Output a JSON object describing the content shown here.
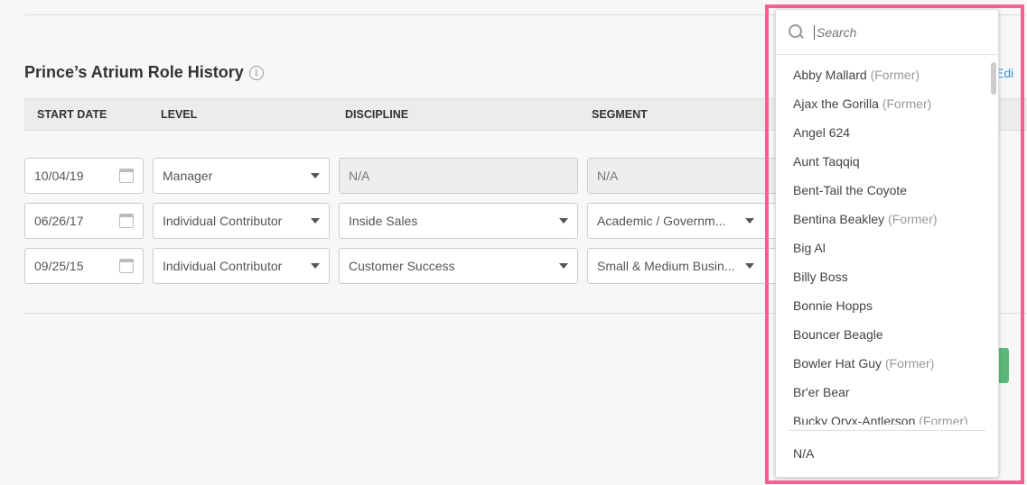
{
  "section": {
    "title": "Prince’s Atrium Role History",
    "info_icon": "info-icon",
    "edit_label": "Edi"
  },
  "columns": [
    "START DATE",
    "LEVEL",
    "DISCIPLINE",
    "SEGMENT"
  ],
  "rows": [
    {
      "date": "10/04/19",
      "level": "Manager",
      "discipline": "N/A",
      "segment": "N/A"
    },
    {
      "date": "06/26/17",
      "level": "Individual Contributor",
      "discipline": "Inside Sales",
      "segment": "Academic / Governm..."
    },
    {
      "date": "09/25/15",
      "level": "Individual Contributor",
      "discipline": "Customer Success",
      "segment": "Small & Medium Busin..."
    }
  ],
  "dropdown": {
    "search_placeholder": "Search",
    "options": [
      {
        "name": "Abby Mallard",
        "tag": "(Former)"
      },
      {
        "name": "Ajax the Gorilla",
        "tag": "(Former)"
      },
      {
        "name": "Angel 624",
        "tag": ""
      },
      {
        "name": "Aunt Taqqiq",
        "tag": ""
      },
      {
        "name": "Bent-Tail the Coyote",
        "tag": ""
      },
      {
        "name": "Bentina Beakley",
        "tag": "(Former)"
      },
      {
        "name": "Big Al",
        "tag": ""
      },
      {
        "name": "Billy Boss",
        "tag": ""
      },
      {
        "name": "Bonnie Hopps",
        "tag": ""
      },
      {
        "name": "Bouncer Beagle",
        "tag": ""
      },
      {
        "name": "Bowler Hat Guy",
        "tag": "(Former)"
      },
      {
        "name": "Br'er Bear",
        "tag": ""
      },
      {
        "name": "Bucky Oryx-Antlerson",
        "tag": "(Former)"
      }
    ],
    "na_option": "N/A"
  },
  "colors": {
    "highlight": "#f5618f",
    "link": "#3a8fd8",
    "button": "#5cb87a"
  }
}
